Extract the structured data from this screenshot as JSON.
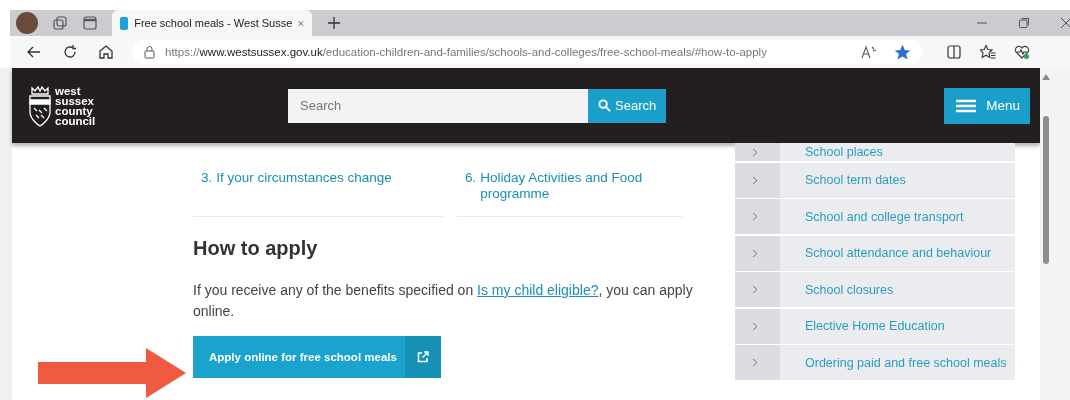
{
  "browser": {
    "tabs": [
      {
        "title": "Free school meals - West Susse",
        "selected": true
      }
    ],
    "address_bar": {
      "url": {
        "scheme": "https://",
        "host": "www.westsussex.gov.uk",
        "path": "/education-children-and-families/schools-and-colleges/free-school-meals/#how-to-apply"
      },
      "favorite": true
    }
  },
  "site_header": {
    "logo_lines": [
      "west",
      "sussex",
      "county",
      "council"
    ],
    "search": {
      "placeholder": "Search"
    },
    "search_button": "Search",
    "menu_button": "Menu"
  },
  "contents_links": [
    {
      "number": "3.",
      "label": "If your circumstances change"
    },
    {
      "number": "6.",
      "label": "Holiday Activities and Food programme"
    }
  ],
  "section": {
    "heading": "How to apply",
    "paragraph_start": "If you receive any of the benefits specified on ",
    "link": "Is my child eligible?",
    "paragraph_end": ", you can apply online.",
    "button": "Apply online for free school meals"
  },
  "sidebar": {
    "items": [
      "School places",
      "School term dates",
      "School and college transport",
      "School attendance and behaviour",
      "School closures",
      "Elective Home Education",
      "Ordering paid and free school meals"
    ]
  }
}
